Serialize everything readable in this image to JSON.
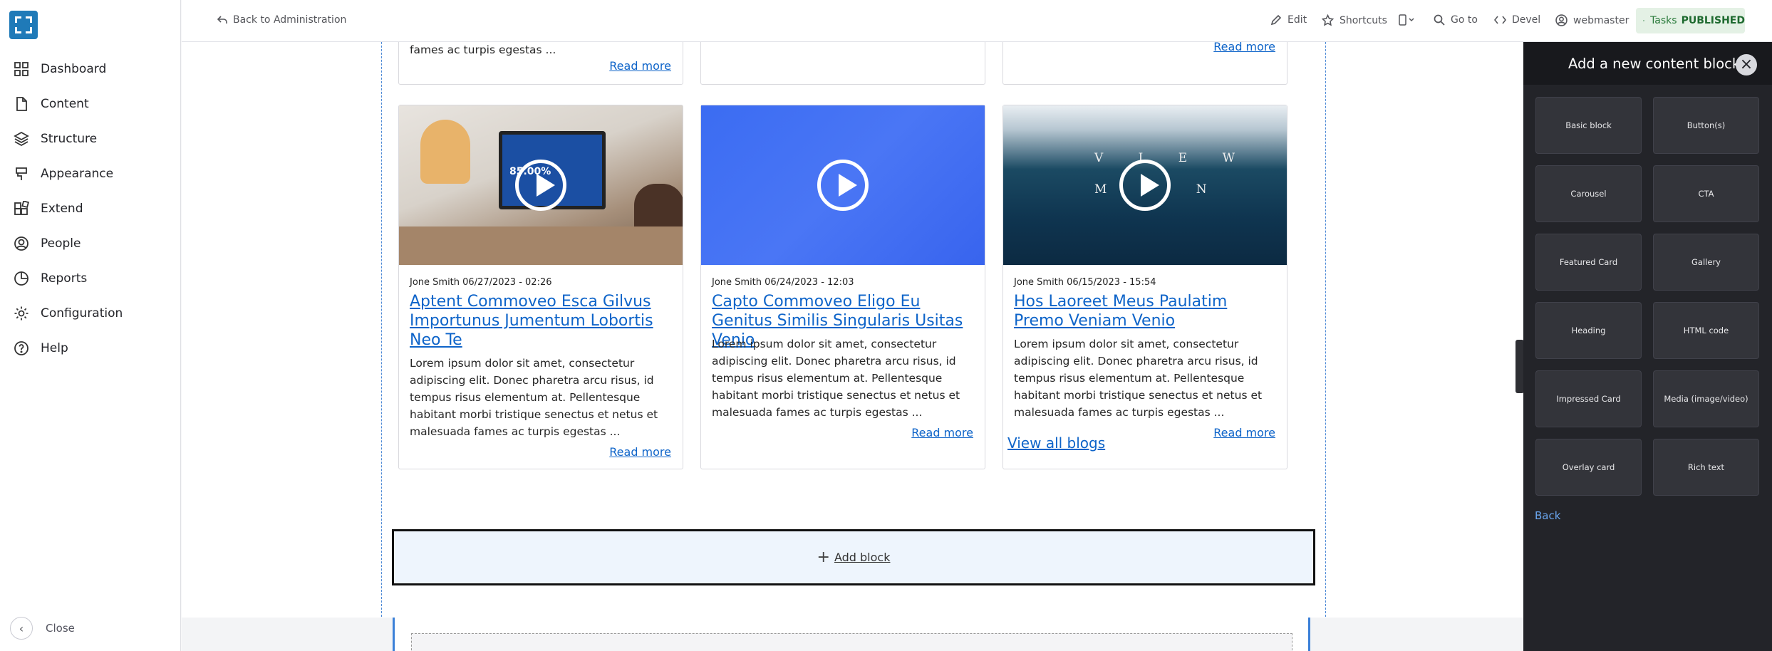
{
  "sidebar": {
    "items": [
      {
        "label": "Dashboard",
        "icon": "grid-icon"
      },
      {
        "label": "Content",
        "icon": "file-icon"
      },
      {
        "label": "Structure",
        "icon": "layers-icon"
      },
      {
        "label": "Appearance",
        "icon": "paint-icon"
      },
      {
        "label": "Extend",
        "icon": "puzzle-icon"
      },
      {
        "label": "People",
        "icon": "user-icon"
      },
      {
        "label": "Reports",
        "icon": "pie-chart-icon"
      },
      {
        "label": "Configuration",
        "icon": "gear-icon"
      },
      {
        "label": "Help",
        "icon": "help-icon"
      }
    ],
    "close_label": "Close"
  },
  "topbar": {
    "back_label": "Back to Administration",
    "edit_label": "Edit",
    "shortcuts_label": "Shortcuts",
    "goto_label": "Go to",
    "devel_label": "Devel",
    "user_label": "webmaster",
    "tasks_label": "Tasks",
    "status_label": "PUBLISHED"
  },
  "top_cards": [
    {
      "excerpt_end": "fames ac turpis egestas ...",
      "read_more": "Read more"
    },
    {
      "read_more": ""
    },
    {
      "read_more": "Read more"
    }
  ],
  "cards": [
    {
      "meta": "Jone Smith 06/27/2023 - 02:26",
      "title": "Aptent Commoveo Esca Gilvus Importunus Jumentum Lobortis Neo Te",
      "body": "Lorem ipsum dolor sit amet, consectetur adipiscing elit. Donec pharetra arcu risus, id tempus risus elementum at. Pellentesque habitant morbi tristique senectus et netus et malesuada fames ac turpis egestas ...",
      "read_more": "Read more"
    },
    {
      "meta": "Jone Smith 06/24/2023 - 12:03",
      "title": "Capto Commoveo Eligo Eu Genitus Similis Singularis Usitas Venio",
      "body": "Lorem ipsum dolor sit amet, consectetur adipiscing elit. Donec pharetra arcu risus, id tempus risus elementum at. Pellentesque habitant morbi tristique senectus et netus et malesuada fames ac turpis egestas ...",
      "read_more": "Read more"
    },
    {
      "meta": "Jone Smith 06/15/2023 - 15:54",
      "title": "Hos Laoreet Meus Paulatim Premo Veniam Venio",
      "body": "Lorem ipsum dolor sit amet, consectetur adipiscing elit. Donec pharetra arcu risus, id tempus risus elementum at. Pellentesque habitant morbi tristique senectus et netus et malesuada fames ac turpis egestas ...",
      "read_more": "Read more"
    }
  ],
  "image_texts": {
    "screen": "85.00%",
    "wave_top": "V I E W",
    "wave_bottom": "M N"
  },
  "view_all": "View all blogs",
  "add_block": "Add block",
  "panel": {
    "title": "Add a new content block",
    "blocks": [
      "Basic block",
      "Button(s)",
      "Carousel",
      "CTA",
      "Featured Card",
      "Gallery",
      "Heading",
      "HTML code",
      "Impressed Card",
      "Media (image/video)",
      "Overlay card",
      "Rich text"
    ],
    "back": "Back"
  },
  "colors": {
    "brand": "#1f7ab8",
    "link": "#0e64c9",
    "panel_bg": "#232429",
    "published": "#2a7a3b"
  }
}
